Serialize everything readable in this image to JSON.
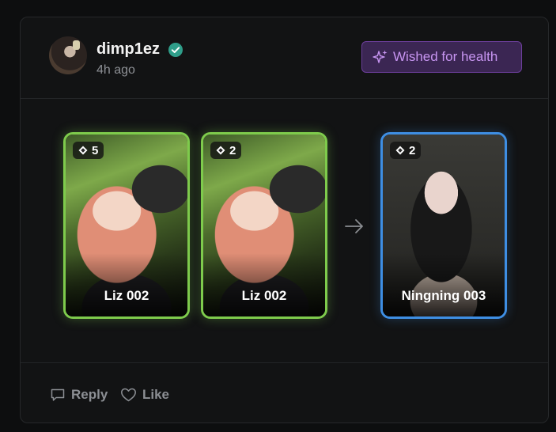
{
  "post": {
    "username": "dimp1ez",
    "time_ago": "4h ago",
    "wish_button_label": "Wished for health",
    "verified_icon": "verified-check-icon",
    "accent_colors": {
      "give_border": "#7ecb4c",
      "receive_border": "#3e8ee3",
      "wish_bg": "#3b2653",
      "wish_text": "#c795f1"
    }
  },
  "trade": {
    "giving": [
      {
        "name": "Liz 002",
        "count": "5"
      },
      {
        "name": "Liz 002",
        "count": "2"
      }
    ],
    "receiving": [
      {
        "name": "Ningning 003",
        "count": "2"
      }
    ],
    "arrow_icon": "arrow-right-icon"
  },
  "actions": {
    "reply_label": "Reply",
    "like_label": "Like"
  }
}
